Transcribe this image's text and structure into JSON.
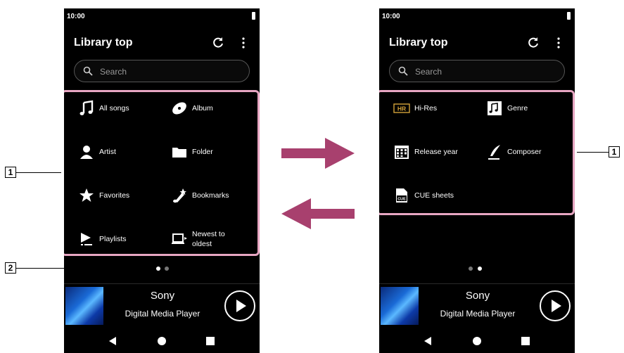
{
  "left_screen": {
    "status_time": "10:00",
    "title": "Library top",
    "search_placeholder": "Search",
    "menu": [
      {
        "label": "All songs",
        "icon": "music-note-icon"
      },
      {
        "label": "Album",
        "icon": "disc-icon"
      },
      {
        "label": "Artist",
        "icon": "person-icon"
      },
      {
        "label": "Folder",
        "icon": "folder-icon"
      },
      {
        "label": "Favorites",
        "icon": "star-icon"
      },
      {
        "label": "Bookmarks",
        "icon": "bookmark-note-icon"
      },
      {
        "label": "Playlists",
        "icon": "playlist-icon"
      },
      {
        "label_line1": "Newest to",
        "label_line2": "oldest",
        "icon": "newest-icon"
      }
    ],
    "page_index": 1,
    "page_count": 2,
    "now_playing": {
      "title": "Sony",
      "subtitle": "Digital Media Player"
    }
  },
  "right_screen": {
    "status_time": "10:00",
    "title": "Library top",
    "search_placeholder": "Search",
    "menu": [
      {
        "label": "Hi-Res",
        "icon": "hi-res-icon",
        "badge": "HR"
      },
      {
        "label": "Genre",
        "icon": "genre-icon"
      },
      {
        "label": "Release year",
        "icon": "calendar-icon"
      },
      {
        "label": "Composer",
        "icon": "quill-icon"
      },
      {
        "label": "CUE sheets",
        "icon": "cue-sheet-icon",
        "badge": "CUE"
      }
    ],
    "page_index": 2,
    "page_count": 2,
    "now_playing": {
      "title": "Sony",
      "subtitle": "Digital Media Player"
    }
  },
  "callouts": {
    "left_one": "1",
    "left_two": "2",
    "right_one": "1"
  },
  "colors": {
    "highlight_border": "#e7a6c2",
    "arrow": "#a8406e",
    "screen_bg": "#000000"
  }
}
